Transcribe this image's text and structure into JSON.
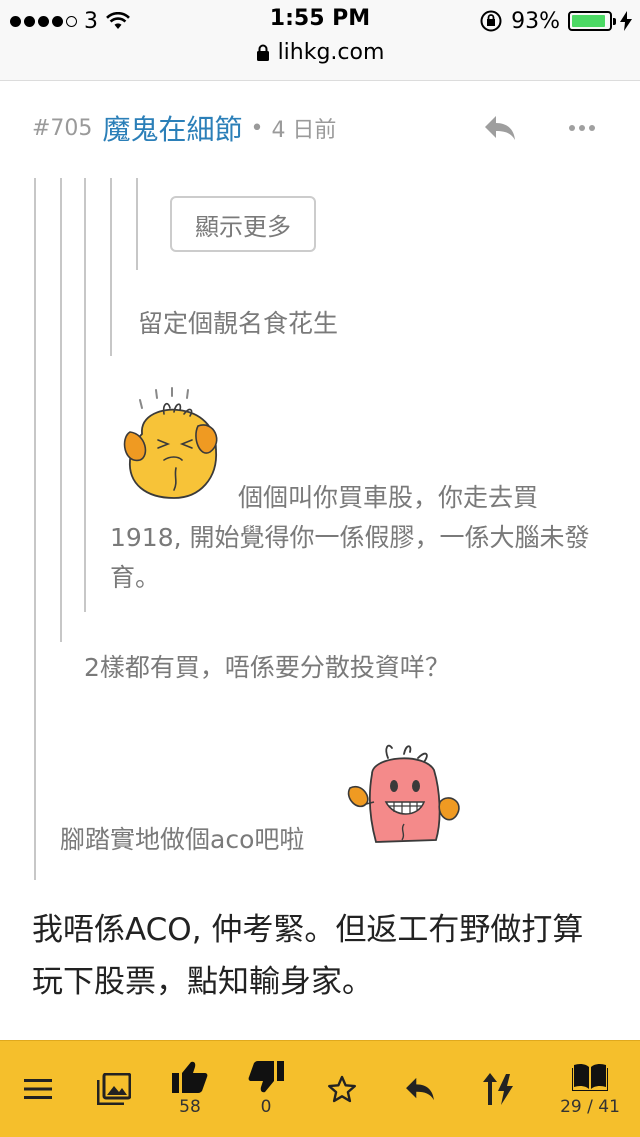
{
  "status_bar": {
    "carrier": "3",
    "time": "1:55 PM",
    "battery_pct": "93%",
    "url": "lihkg.com",
    "battery_level": 0.93,
    "battery_color": "#4cd964"
  },
  "post": {
    "number": "#705",
    "username": "魔鬼在細節",
    "separator": "•",
    "time_ago": "4 日前",
    "show_more_label": "顯示更多",
    "quote_level4": "留定個靚名食花生",
    "quote_level3": "個個叫你買車股，你走去買1918, 開始覺得你一係假膠，一係大腦未發育。",
    "quote_level2": "2樣都有買，唔係要分散投資咩？",
    "quote_level1": "腳踏實地做個aco吧啦",
    "body": "我唔係ACO, 仲考緊。但返工冇野做打算玩下股票，點知輸身家。",
    "username_color": "#2b7fb8"
  },
  "toolbar": {
    "like_count": "58",
    "dislike_count": "0",
    "pages": "29 / 41",
    "background_color": "#f5bf2c"
  },
  "icons": {
    "menu": "menu-icon",
    "image": "image-icon",
    "like": "thumbs-up-icon",
    "dislike": "thumbs-down-icon",
    "star": "star-icon",
    "reply": "reply-icon",
    "sort": "sort-icon",
    "pages": "book-icon",
    "more": "more-icon",
    "lock": "lock-icon",
    "wifi": "wifi-icon"
  }
}
